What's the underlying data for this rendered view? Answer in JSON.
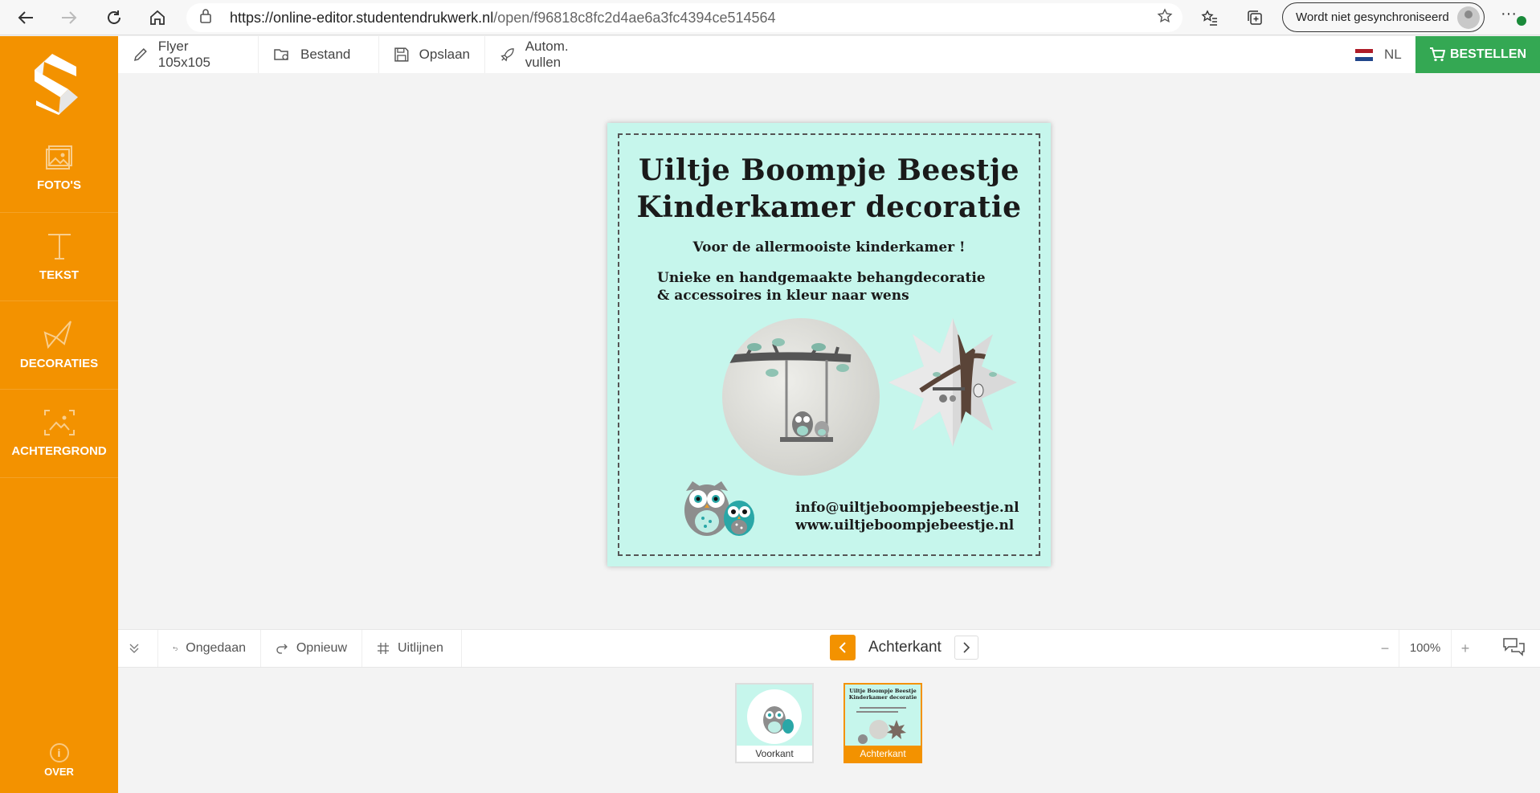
{
  "browser": {
    "url_host": "https://online-editor.studentendrukwerk.nl",
    "url_path": "/open/f96818c8fc2d4ae6a3fc4394ce514564",
    "sync_label": "Wordt niet gesynchroniseerd"
  },
  "sidebar": {
    "items": [
      {
        "label": "FOTO'S",
        "icon": "image-icon"
      },
      {
        "label": "TEKST",
        "icon": "text-icon"
      },
      {
        "label": "DECORATIES",
        "icon": "origami-bird-icon"
      },
      {
        "label": "ACHTERGROND",
        "icon": "background-icon"
      }
    ],
    "about_label": "OVER"
  },
  "toolbar": {
    "format_label": "Flyer 105x105",
    "file_label": "Bestand",
    "save_label": "Opslaan",
    "autofill_label": "Autom. vullen",
    "lang_label": "NL",
    "order_label": "BESTELLEN"
  },
  "card": {
    "title_line1": "Uiltje Boompje Beestje",
    "title_line2": "Kinderkamer decoratie",
    "subtitle": "Voor de allermooiste kinderkamer !",
    "desc_line1": "Unieke en handgemaakte behangdecoratie",
    "desc_line2": "& accessoires in kleur naar wens",
    "email": "info@uiltjeboompjebeestje.nl",
    "website": "www.uiltjeboompjebeestje.nl",
    "background_color": "#c6f6ec"
  },
  "bottom": {
    "undo_label": "Ongedaan",
    "redo_label": "Opnieuw",
    "align_label": "Uitlijnen",
    "page_label": "Achterkant",
    "zoom_value": "100%"
  },
  "thumbnails": [
    {
      "label": "Voorkant",
      "active": false
    },
    {
      "label": "Achterkant",
      "active": true
    }
  ],
  "colors": {
    "accent": "#f39200",
    "order": "#34a853"
  }
}
